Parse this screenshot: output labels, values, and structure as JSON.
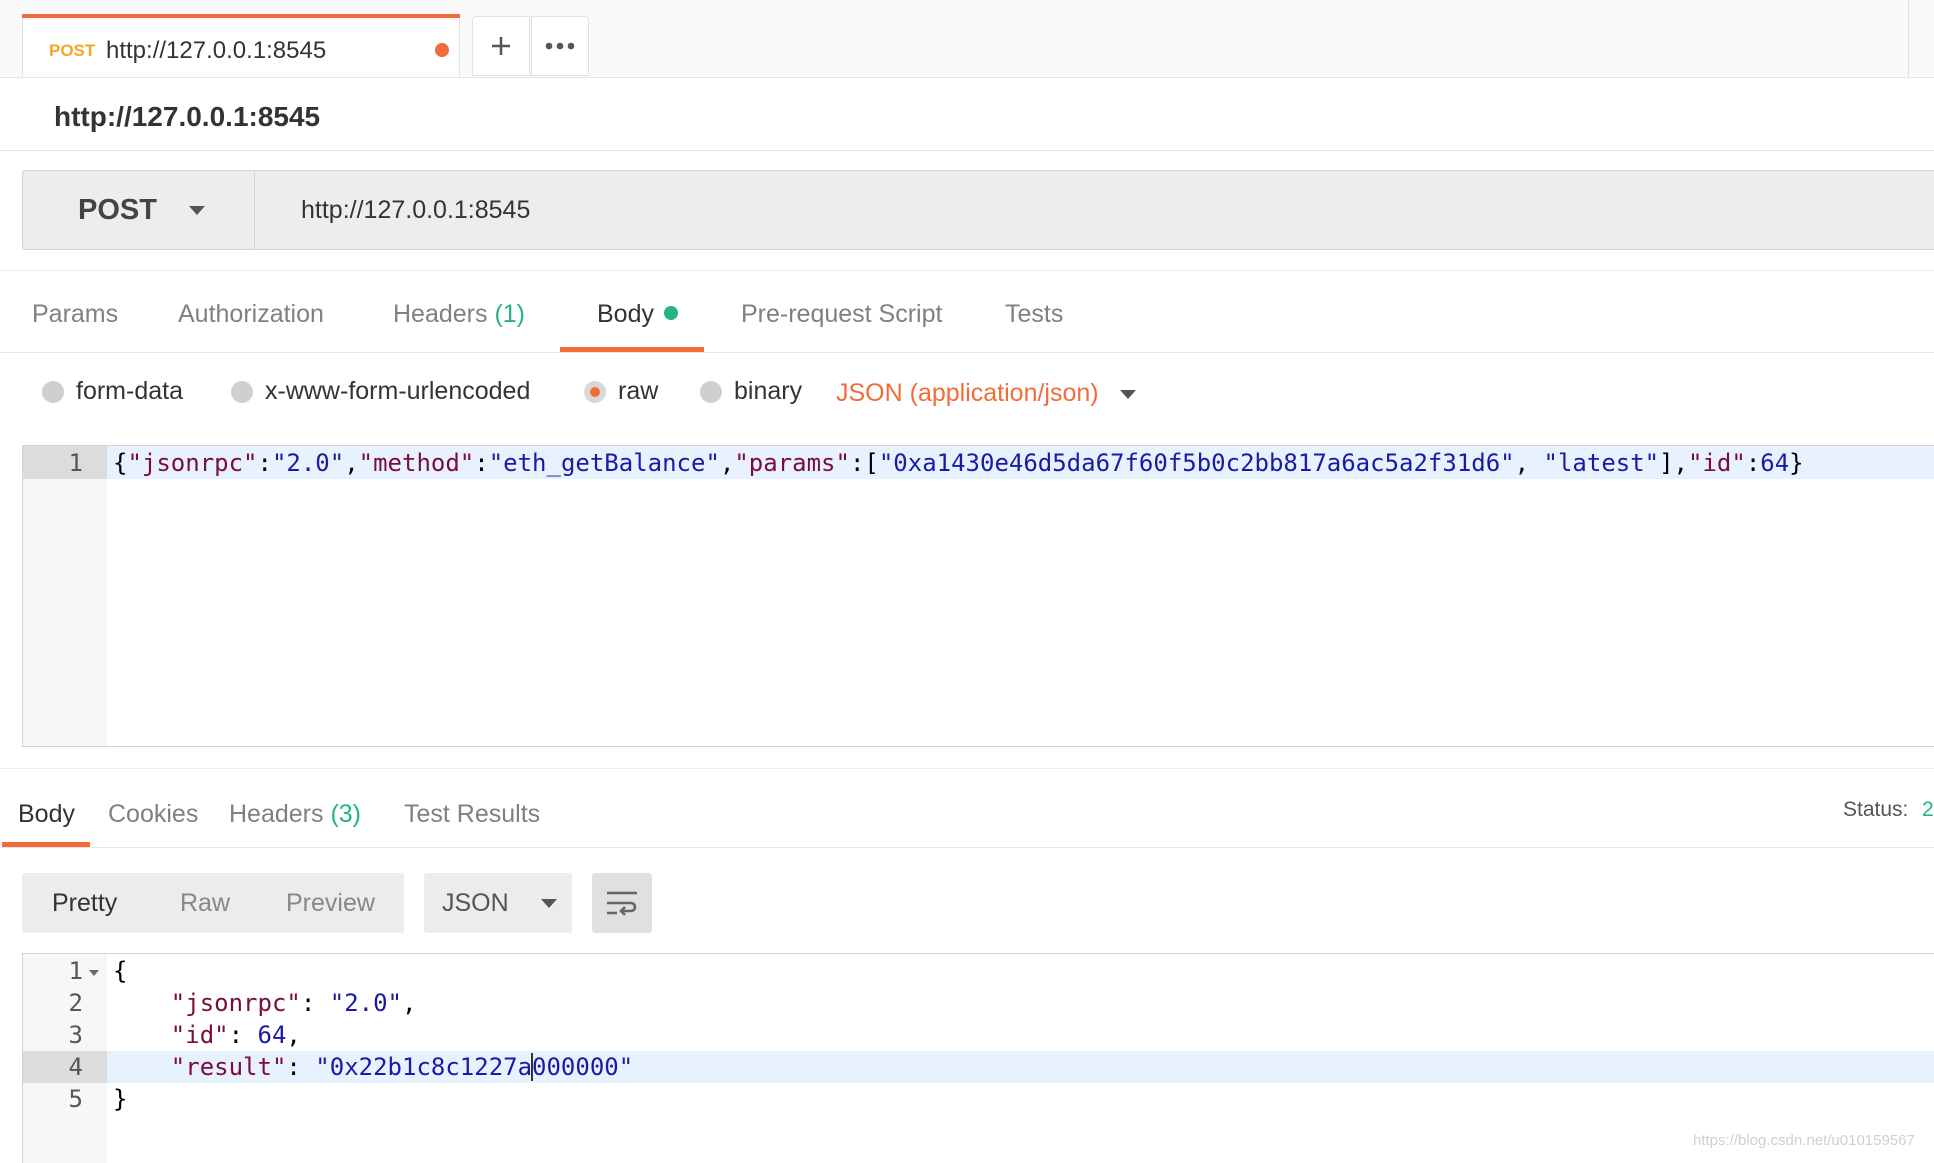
{
  "tab": {
    "method": "POST",
    "title": "http://127.0.0.1:8545",
    "icons": [
      "plus-icon",
      "more-icon"
    ]
  },
  "request_name": "http://127.0.0.1:8545",
  "url_bar": {
    "method": "POST",
    "url": "http://127.0.0.1:8545"
  },
  "request_tabs": {
    "params": "Params",
    "authorization": "Authorization",
    "headers": "Headers",
    "headers_count": "(1)",
    "body": "Body",
    "prerequest": "Pre-request Script",
    "tests": "Tests"
  },
  "body_types": {
    "form_data": "form-data",
    "urlencoded": "x-www-form-urlencoded",
    "raw": "raw",
    "binary": "binary",
    "selected": "raw",
    "content_type": "JSON (application/json)"
  },
  "request_body": {
    "line_number": "1",
    "code": "{\"jsonrpc\":\"2.0\",\"method\":\"eth_getBalance\",\"params\":[\"0xa1430e46d5da67f60f5b0c2bb817a6ac5a2f31d6\", \"latest\"],\"id\":64}"
  },
  "response_tabs": {
    "body": "Body",
    "cookies": "Cookies",
    "headers": "Headers",
    "headers_count": "(3)",
    "test_results": "Test Results",
    "status_label": "Status:",
    "status_value": "2"
  },
  "response_toolbar": {
    "pretty": "Pretty",
    "raw": "Raw",
    "preview": "Preview",
    "format": "JSON"
  },
  "response_body": {
    "line_numbers": [
      "1",
      "2",
      "3",
      "4",
      "5"
    ],
    "lines": [
      "{",
      "    \"jsonrpc\": \"2.0\",",
      "    \"id\": 64,",
      "    \"result\": \"0x22b1c8c1227a000000\"",
      "}"
    ]
  },
  "watermark": "https://blog.csdn.net/u010159567",
  "colors": {
    "accent": "#f26b3a",
    "method_tab": "#f5a623",
    "count_green": "#26b47f",
    "json_key": "#7a0d3d",
    "json_string": "#1a1aa6"
  }
}
